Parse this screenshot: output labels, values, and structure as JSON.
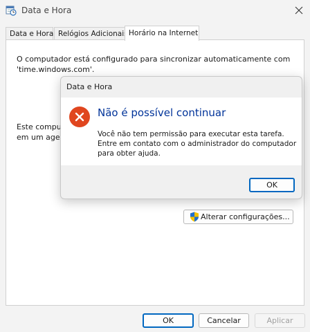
{
  "window": {
    "title": "Data e Hora",
    "close_symbol": "✕"
  },
  "tabs": [
    {
      "label": "Data e Hora"
    },
    {
      "label": "Relógios Adicionais"
    },
    {
      "label": "Horário na Internet"
    }
  ],
  "panel": {
    "sync_text": "O computador está configurado para sincronizar automaticamente com 'time.windows.com'.",
    "partial_text_line1": "Este computador está configurado para sincronizar",
    "partial_text_line2": "em um agendamento.",
    "change_button": "Alterar configurações..."
  },
  "dialog": {
    "title": "Data e Hora",
    "heading": "Não é possível continuar",
    "message": "Você não tem permissão para executar esta tarefa. Entre em contato com o administrador do computador para obter ajuda.",
    "ok_label": "OK",
    "icon": "error-icon",
    "icon_color": "#e0461f"
  },
  "footer": {
    "ok_label": "OK",
    "cancel_label": "Cancelar",
    "apply_label": "Aplicar"
  },
  "colors": {
    "accent": "#0067c0",
    "heading_blue": "#003399"
  }
}
